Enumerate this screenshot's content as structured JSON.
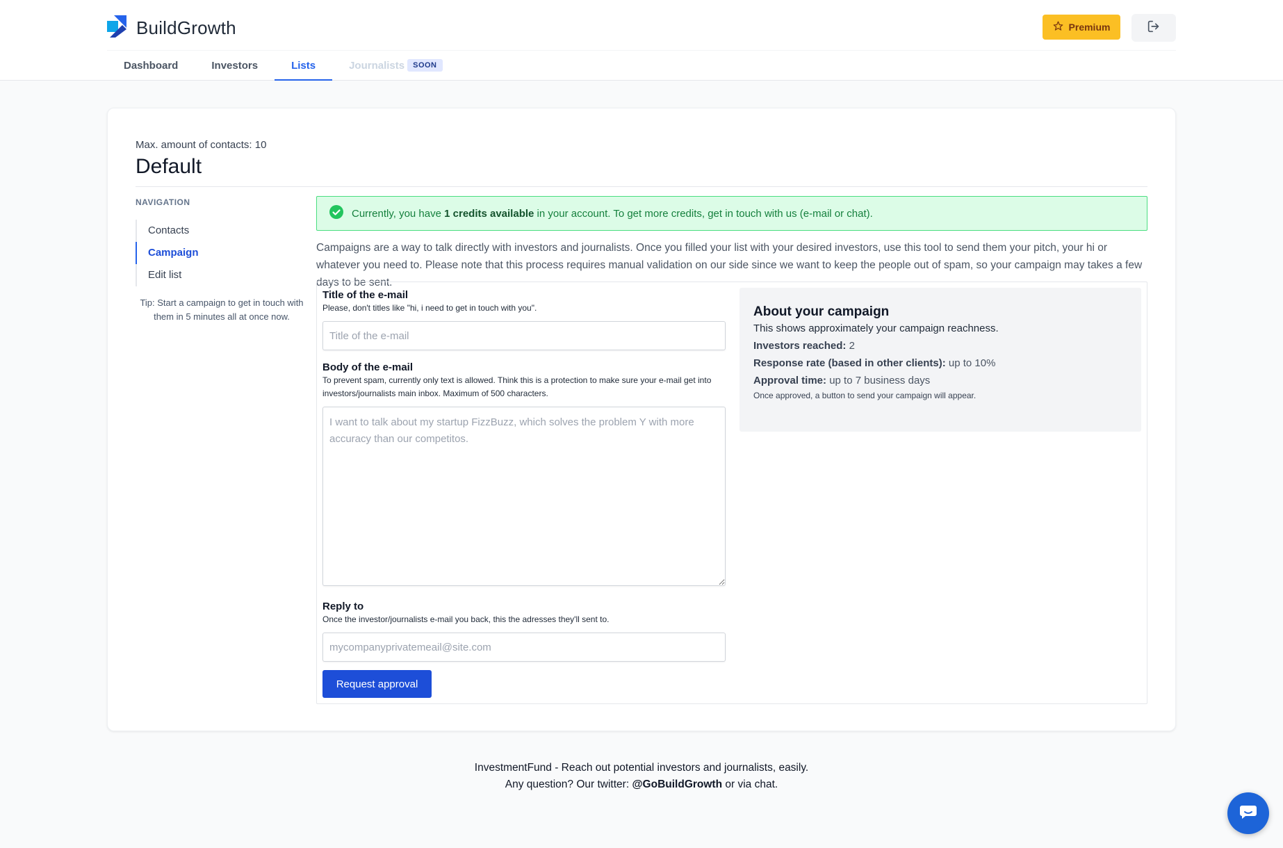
{
  "brand": {
    "name": "BuildGrowth"
  },
  "header": {
    "premium_label": "Premium"
  },
  "tabs": [
    {
      "label": "Dashboard"
    },
    {
      "label": "Investors"
    },
    {
      "label": "Lists"
    },
    {
      "label": "Journalists",
      "badge": "SOON"
    }
  ],
  "list": {
    "max_contacts": "Max. amount of contacts: 10",
    "title": "Default"
  },
  "nav": {
    "heading": "NAVIGATION",
    "items": [
      {
        "label": "Contacts"
      },
      {
        "label": "Campaign"
      },
      {
        "label": "Edit list"
      }
    ],
    "tip": "Tip: Start a campaign to get in touch with them in 5 minutes all at once now."
  },
  "alert": {
    "prefix": "Currently, you have ",
    "credits": "1 credits available",
    "suffix": " in your account. To get more credits, get in touch with us (e-mail or chat)."
  },
  "intro": "Campaigns are a way to talk directly with investors and journalists. Once you filled your list with your desired investors, use this tool to send them your pitch, your hi or whatever you need to. Please note that this process requires manual validation on our side since we want to keep the people out of spam, so your campaign may takes a few days to be sent.",
  "form": {
    "title_label": "Title of the e-mail",
    "title_hint": "Please, don't titles like \"hi, i need to get in touch with you\".",
    "title_placeholder": "Title of the e-mail",
    "title_value": "",
    "body_label": "Body of the e-mail",
    "body_hint": "To prevent spam, currently only text is allowed. Think this is a protection to make sure your e-mail get into investors/journalists main inbox. Maximum of 500 characters.",
    "body_placeholder": "I want to talk about my startup FizzBuzz, which solves the problem Y with more accuracy than our competitos.",
    "body_value": "",
    "reply_label": "Reply to",
    "reply_hint": "Once the investor/journalists e-mail you back, this the adresses they'll sent to.",
    "reply_placeholder": "mycompanyprivatemeail@site.com",
    "reply_value": "",
    "submit_label": "Request approval"
  },
  "about": {
    "title": "About your campaign",
    "subtitle": "This shows approximately your campaign reachness.",
    "investors_label": "Investors reached:",
    "investors_value": "2",
    "response_label": "Response rate (based in other clients):",
    "response_value": "up to 10%",
    "approval_label": "Approval time:",
    "approval_value": "up to 7 business days",
    "note": "Once approved, a button to send your campaign will appear."
  },
  "footer": {
    "line1": "InvestmentFund - Reach out potential investors and journalists, easily.",
    "line2_prefix": "Any question? Our twitter: ",
    "twitter": "@GoBuildGrowth",
    "line2_suffix": " or via chat."
  },
  "colors": {
    "accent": "#2563eb",
    "primary_button": "#1d4ed8",
    "premium": "#fbbf24",
    "success_bg": "#dcfce7",
    "success_text": "#15803d"
  },
  "icons": [
    "buildgrowth-logo-icon",
    "star-icon",
    "logout-icon",
    "check-circle-icon",
    "chat-icon"
  ]
}
